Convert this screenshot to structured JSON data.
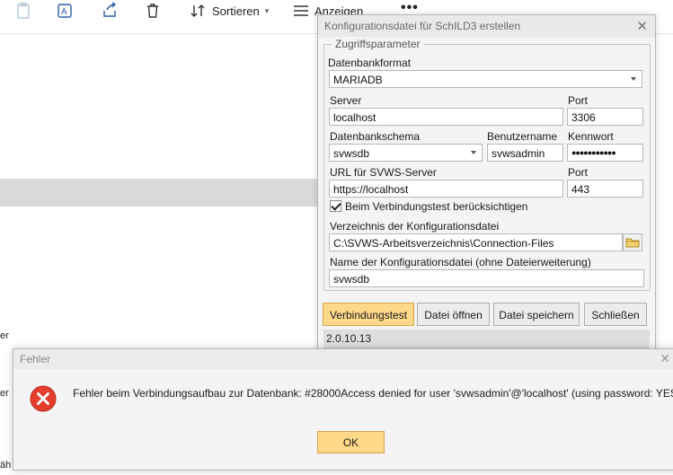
{
  "explorer": {
    "sort_label": "Sortieren",
    "view_label": "Anzeigen",
    "more_label": "•••",
    "left_fragments": [
      "er",
      "er",
      "äh"
    ]
  },
  "config_dialog": {
    "title": "Konfigurationsdatei für SchILD3 erstellen",
    "group_title": "Zugriffsparameter",
    "db_format": {
      "label": "Datenbankformat",
      "value": "MARIADB"
    },
    "server": {
      "label": "Server",
      "value": "localhost"
    },
    "port": {
      "label": "Port",
      "value": "3306"
    },
    "schema": {
      "label": "Datenbankschema",
      "value": "svwsdb"
    },
    "username": {
      "label": "Benutzername",
      "value": "svwsadmin"
    },
    "password": {
      "label": "Kennwort",
      "value": "●●●●●●●●●●●"
    },
    "url": {
      "label": "URL für SVWS-Server",
      "value": "https://localhost"
    },
    "url_port": {
      "label": "Port",
      "value": "443"
    },
    "consider_checkbox": {
      "label": "Beim Verbindungstest berücksichtigen",
      "checked": true
    },
    "directory": {
      "label": "Verzeichnis der Konfigurationsdatei",
      "value": "C:\\SVWS-Arbeitsverzeichnis\\Connection-Files"
    },
    "filename": {
      "label": "Name der Konfigurationsdatei (ohne Dateierweiterung)",
      "value": "svwsdb"
    },
    "buttons": {
      "test": "Verbindungstest",
      "open": "Datei öffnen",
      "save": "Datei speichern",
      "close": "Schließen"
    },
    "version": "2.0.10.13"
  },
  "error_dialog": {
    "title": "Fehler",
    "message": "Fehler beim Verbindungsaufbau zur Datenbank: #28000Access denied for user 'svwsadmin'@'localhost' (using password: YES)",
    "ok_label": "OK"
  },
  "colors": {
    "primary_button": "#ffd88a",
    "error_red": "#e53e2c",
    "dialog_bg": "#f4f4f4"
  }
}
